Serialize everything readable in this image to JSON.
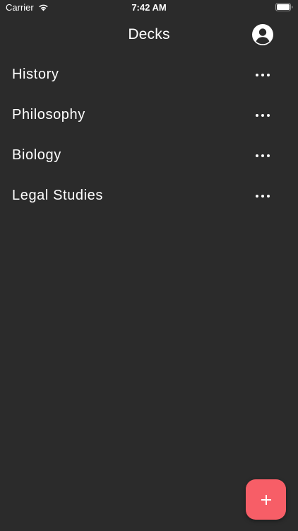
{
  "status_bar": {
    "carrier": "Carrier",
    "time": "7:42 AM",
    "wifi_icon": "wifi-icon",
    "battery_icon": "battery-full-icon"
  },
  "header": {
    "title": "Decks",
    "profile_icon": "user-circle-icon"
  },
  "decks": [
    {
      "label": "History",
      "more_icon": "ellipsis-icon"
    },
    {
      "label": "Philosophy",
      "more_icon": "ellipsis-icon"
    },
    {
      "label": "Biology",
      "more_icon": "ellipsis-icon"
    },
    {
      "label": "Legal Studies",
      "more_icon": "ellipsis-icon"
    }
  ],
  "fab": {
    "icon": "plus-icon",
    "color": "#f75e67"
  },
  "colors": {
    "background": "#2b2b2b",
    "text": "#ffffff",
    "accent": "#f75e67"
  }
}
